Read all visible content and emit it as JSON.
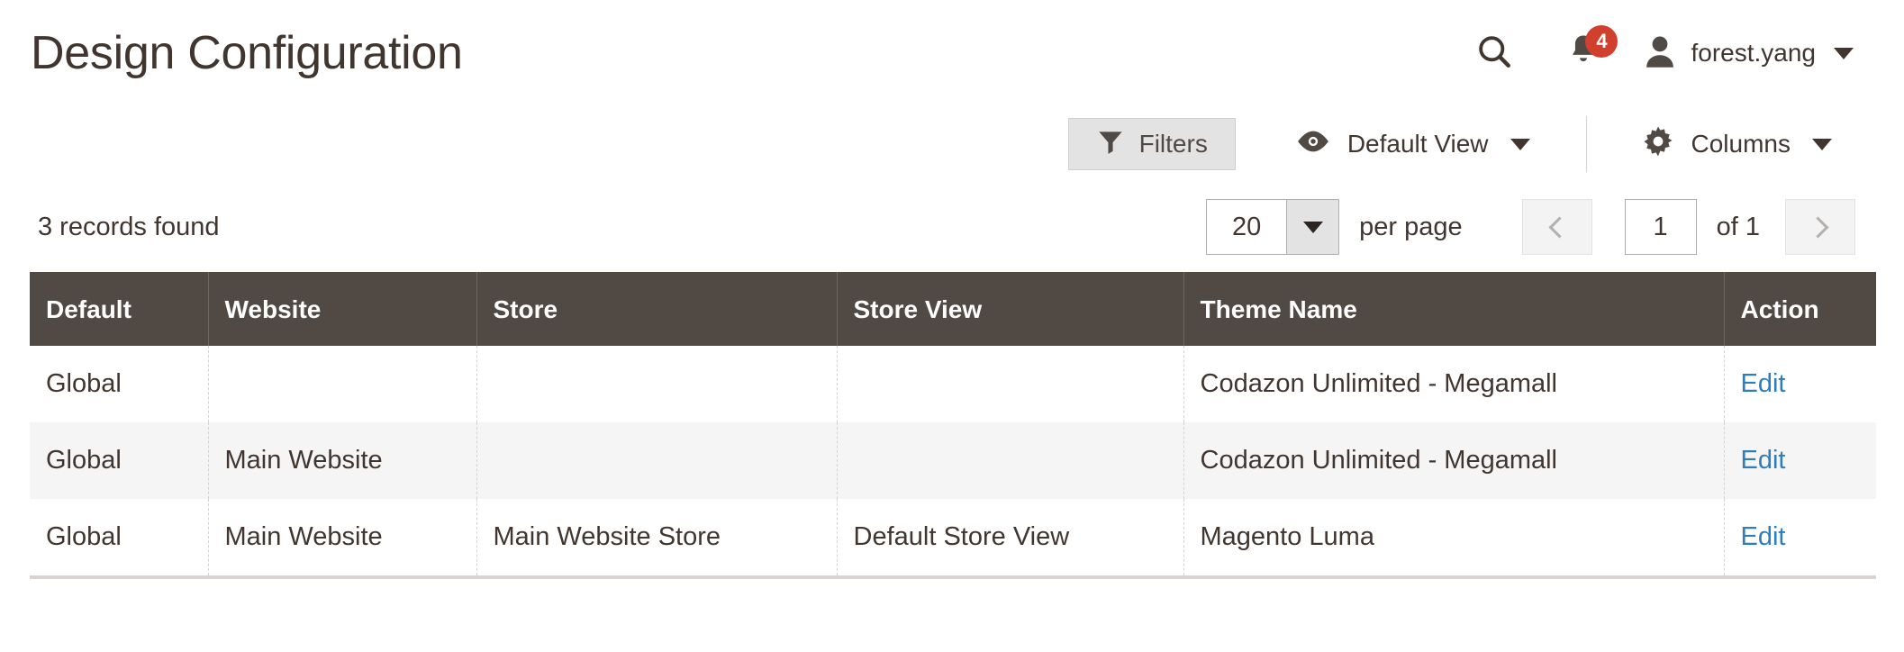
{
  "header": {
    "title": "Design Configuration",
    "search_icon": "search-icon",
    "notifications": {
      "icon": "bell-icon",
      "count": "4"
    },
    "user": {
      "avatar_icon": "user-avatar-icon",
      "name": "forest.yang",
      "caret_icon": "chevron-down-icon"
    }
  },
  "toolbar": {
    "filters": {
      "label": "Filters",
      "icon": "funnel-icon"
    },
    "view": {
      "label": "Default View",
      "icon": "eye-icon",
      "caret_icon": "chevron-down-icon"
    },
    "columns": {
      "label": "Columns",
      "icon": "gear-icon",
      "caret_icon": "chevron-down-icon"
    }
  },
  "grid_meta": {
    "records_found": "3 records found",
    "per_page": {
      "value": "20",
      "label": "per page",
      "toggle_icon": "chevron-down-icon"
    },
    "pagination": {
      "prev_icon": "chevron-left-icon",
      "next_icon": "chevron-right-icon",
      "current_page": "1",
      "of_label": "of 1"
    }
  },
  "grid": {
    "columns": [
      "Default",
      "Website",
      "Store",
      "Store View",
      "Theme Name",
      "Action"
    ],
    "rows": [
      {
        "default": "Global",
        "website": "",
        "store": "",
        "store_view": "",
        "theme_name": "Codazon Unlimited - Megamall",
        "action": "Edit"
      },
      {
        "default": "Global",
        "website": "Main Website",
        "store": "",
        "store_view": "",
        "theme_name": "Codazon Unlimited - Megamall",
        "action": "Edit"
      },
      {
        "default": "Global",
        "website": "Main Website",
        "store": "Main Website Store",
        "store_view": "Default Store View",
        "theme_name": "Magento Luma",
        "action": "Edit"
      }
    ]
  },
  "colors": {
    "header_bg": "#514943",
    "accent_link": "#2e7ebd",
    "badge_bg": "#d1402d",
    "row_alt_bg": "#f5f5f5",
    "text": "#41362f"
  }
}
